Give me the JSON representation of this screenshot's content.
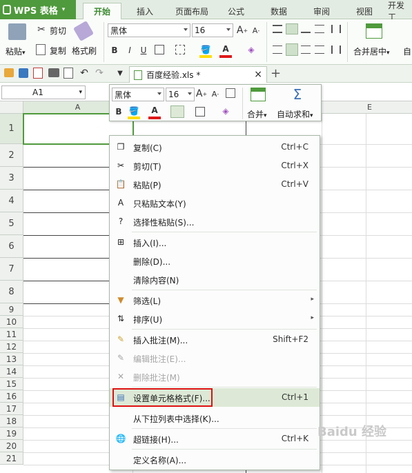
{
  "app": {
    "logo_text": "WPS 表格",
    "logo_dd": "▾"
  },
  "menu_tabs": [
    {
      "label": "开始",
      "active": true
    },
    {
      "label": "插入"
    },
    {
      "label": "页面布局"
    },
    {
      "label": "公式"
    },
    {
      "label": "数据"
    },
    {
      "label": "审阅"
    },
    {
      "label": "视图"
    },
    {
      "label": "开发工"
    }
  ],
  "ribbon": {
    "paste": "粘贴",
    "paste_dd": "▾",
    "cut": "剪切",
    "copy": "复制",
    "format_painter": "格式刷",
    "font_name": "黑体",
    "font_size": "16",
    "grow": "A",
    "shrink": "A",
    "bold": "B",
    "italic": "I",
    "underline": "U",
    "font_color_a": "A",
    "merge_center": "合并居中",
    "merge_dd": "▾",
    "wrap": "自"
  },
  "doc_tab": {
    "name": "百度经验.xls *",
    "close": "×",
    "add": "+"
  },
  "namebox": {
    "value": "A1",
    "dd": "▾"
  },
  "columns": [
    "A",
    "E"
  ],
  "rows": [
    "1",
    "2",
    "3",
    "4",
    "5",
    "6",
    "7",
    "8",
    "9",
    "10",
    "11",
    "12",
    "13",
    "14",
    "15",
    "16",
    "17",
    "18",
    "19",
    "20",
    "21"
  ],
  "minibar": {
    "font_name": "黑体",
    "font_size": "16",
    "grow": "A",
    "shrink": "A",
    "bold": "B",
    "font_color_a": "A",
    "merge": "合并",
    "autosum": "自动求和",
    "dd": "▾"
  },
  "context_menu": [
    {
      "label": "复制(C)",
      "shortcut": "Ctrl+C",
      "icon": "copy-icon",
      "glyph": "❐"
    },
    {
      "label": "剪切(T)",
      "shortcut": "Ctrl+X",
      "icon": "scissors-icon",
      "glyph": "✂"
    },
    {
      "label": "粘贴(P)",
      "shortcut": "Ctrl+V",
      "icon": "paste-icon",
      "glyph": "📋"
    },
    {
      "label": "只粘贴文本(Y)",
      "shortcut": "",
      "icon": "paste-text-icon",
      "glyph": "A"
    },
    {
      "label": "选择性粘贴(S)...",
      "shortcut": "",
      "icon": "paste-special-icon",
      "glyph": "?"
    },
    {
      "label": "插入(I)...",
      "shortcut": "",
      "icon": "insert-icon",
      "glyph": "⊞"
    },
    {
      "label": "删除(D)...",
      "shortcut": "",
      "icon": "",
      "glyph": ""
    },
    {
      "label": "清除内容(N)",
      "shortcut": "",
      "icon": "",
      "glyph": ""
    },
    {
      "label": "筛选(L)",
      "shortcut": "",
      "icon": "filter-icon",
      "glyph": "▼",
      "submenu": true
    },
    {
      "label": "排序(U)",
      "shortcut": "",
      "icon": "sort-icon",
      "glyph": "⇅",
      "submenu": true
    },
    {
      "label": "插入批注(M)...",
      "shortcut": "Shift+F2",
      "icon": "comment-icon",
      "glyph": "✎"
    },
    {
      "label": "编辑批注(E)...",
      "shortcut": "",
      "icon": "edit-comment-icon",
      "glyph": "✎",
      "disabled": true
    },
    {
      "label": "删除批注(M)",
      "shortcut": "",
      "icon": "delete-comment-icon",
      "glyph": "✕",
      "disabled": true
    },
    {
      "label": "设置单元格格式(F)...",
      "shortcut": "Ctrl+1",
      "icon": "format-cells-icon",
      "glyph": "▤",
      "highlighted": true
    },
    {
      "label": "从下拉列表中选择(K)...",
      "shortcut": "",
      "icon": "",
      "glyph": ""
    },
    {
      "label": "超链接(H)...",
      "shortcut": "Ctrl+K",
      "icon": "hyperlink-icon",
      "glyph": "🌐"
    },
    {
      "label": "定义名称(A)...",
      "shortcut": "",
      "icon": "",
      "glyph": ""
    }
  ],
  "submenu_arrow": "▸",
  "watermark": "Baidu 经验",
  "colors": {
    "accent": "#4f9a3c",
    "highlight": "#dde9d6",
    "red_box": "#dd1111"
  }
}
